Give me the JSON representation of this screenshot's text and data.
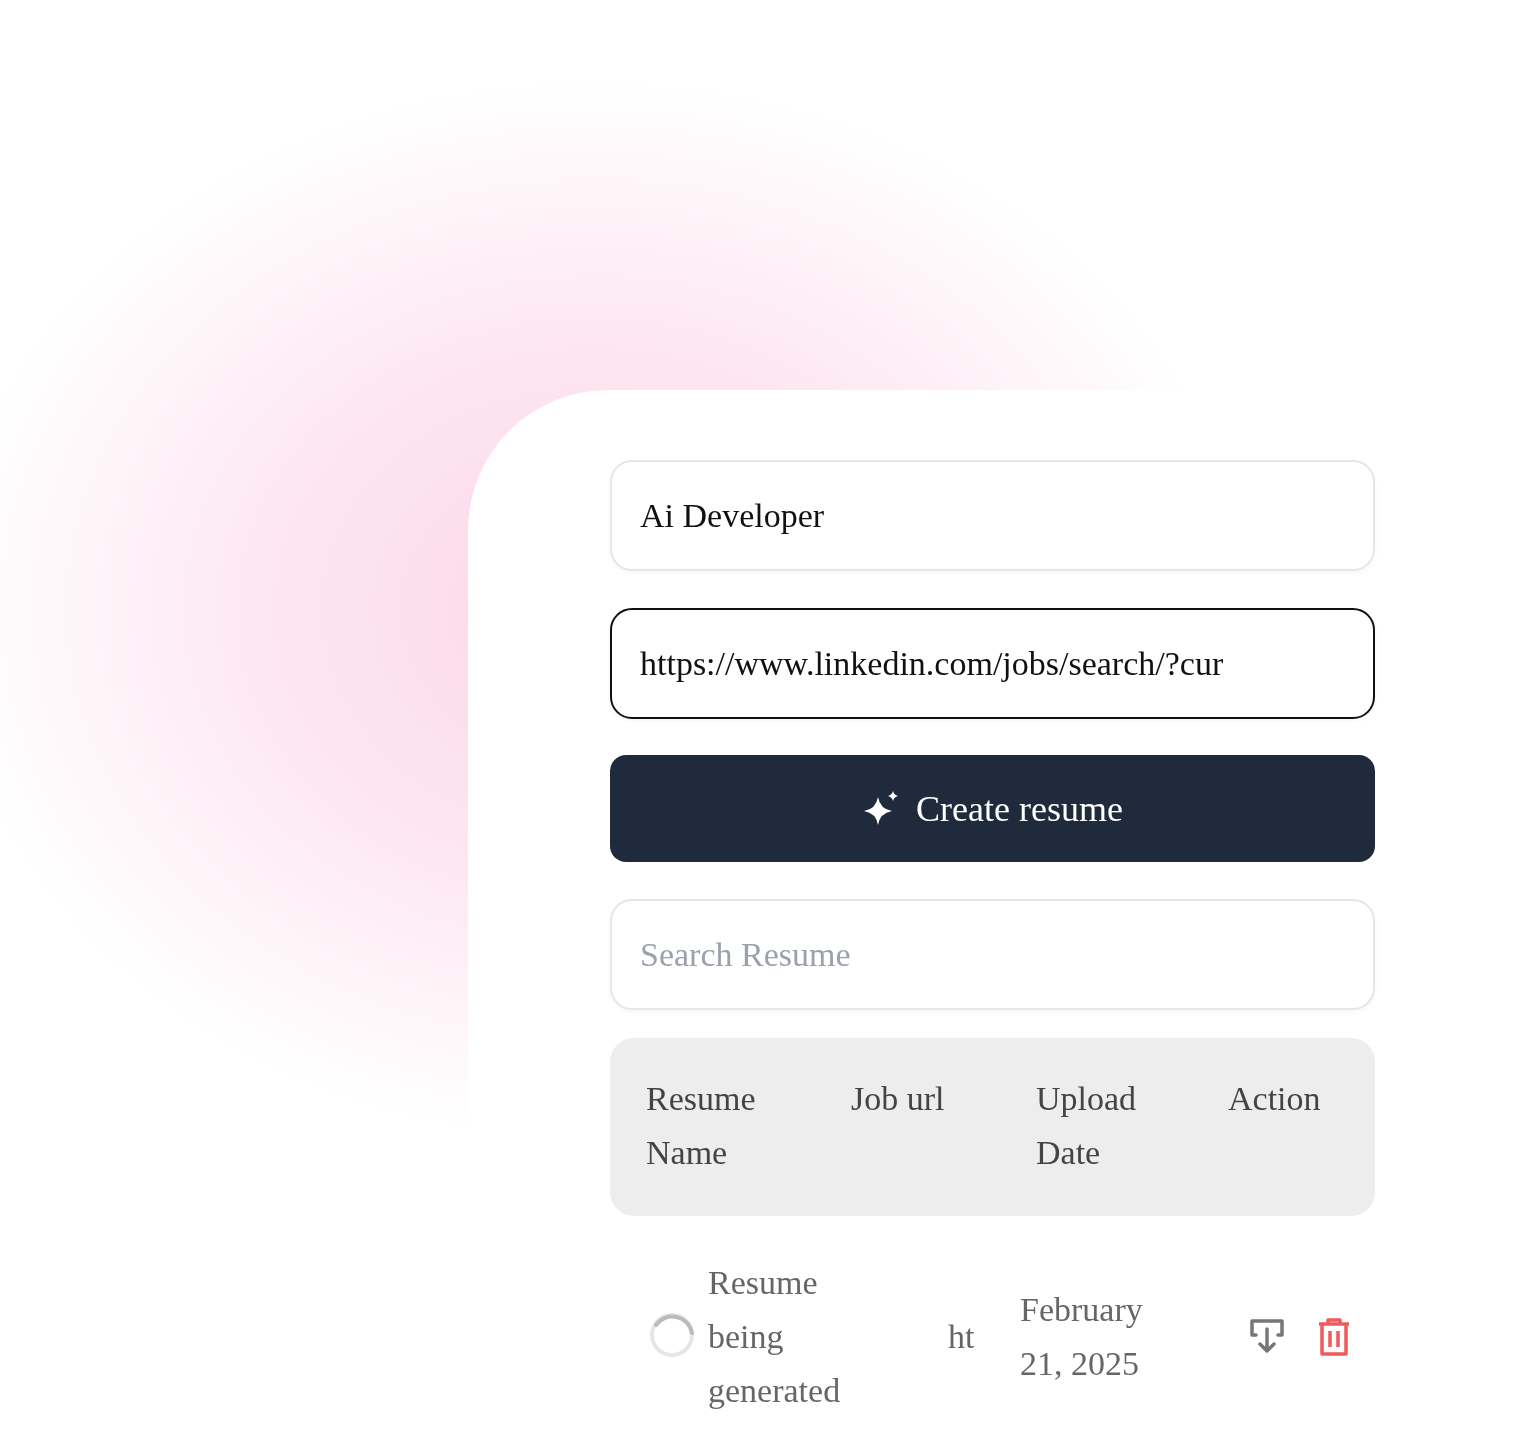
{
  "fields": [
    {
      "value": "Ai Developer",
      "focused": false
    },
    {
      "value": "https://www.linkedin.com/jobs/search/?cur",
      "focused": true
    }
  ],
  "create_button": {
    "label": "Create resume"
  },
  "search": {
    "placeholder": "Search Resume"
  },
  "table": {
    "columns": [
      "Resume Name",
      "Job url",
      "Upload Date",
      "Action"
    ],
    "rows": [
      {
        "loading": true,
        "name": "Resume being generated",
        "job_url": "ht",
        "upload_date": "February 21, 2025"
      }
    ]
  }
}
